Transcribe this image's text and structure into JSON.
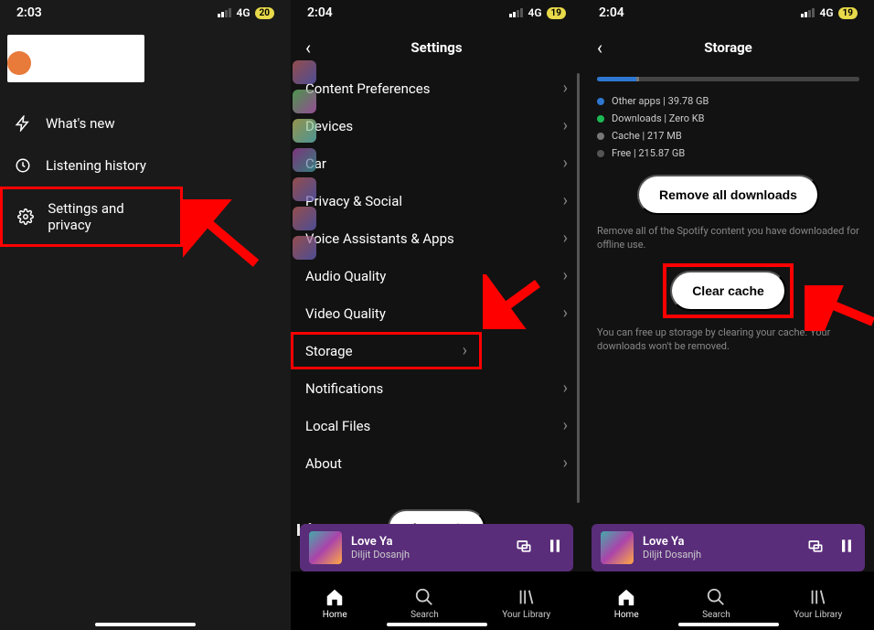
{
  "phone1": {
    "time": "2:03",
    "network": "4G",
    "battery": "20",
    "menu": [
      {
        "icon": "bolt",
        "label": "What's new"
      },
      {
        "icon": "history",
        "label": "Listening history"
      },
      {
        "icon": "gear",
        "label": "Settings and privacy",
        "highlight": true
      }
    ]
  },
  "phone2": {
    "time": "2:04",
    "network": "4G",
    "battery": "19",
    "title": "Settings",
    "items": [
      "Content Preferences",
      "Devices",
      "Car",
      "Privacy & Social",
      "Voice Assistants & Apps",
      "Audio Quality",
      "Video Quality",
      "Storage",
      "Notifications",
      "Local Files",
      "About"
    ],
    "highlight_index": 7,
    "logout": "Log out",
    "nowplaying": {
      "title": "Love Ya",
      "artist": "Diljit Dosanjh"
    },
    "nav": {
      "home": "Home",
      "search": "Search",
      "library": "Your Library"
    }
  },
  "phone3": {
    "time": "2:04",
    "network": "4G",
    "battery": "19",
    "title": "Storage",
    "segments": [
      {
        "color": "#2e77d0",
        "pct": 15
      },
      {
        "color": "#1db954",
        "pct": 0
      },
      {
        "color": "#777",
        "pct": 1
      },
      {
        "color": "#444",
        "pct": 84
      }
    ],
    "legend": [
      {
        "color": "#2e77d0",
        "label": "Other apps | 39.78 GB"
      },
      {
        "color": "#1db954",
        "label": "Downloads | Zero KB"
      },
      {
        "color": "#777",
        "label": "Cache | 217 MB"
      },
      {
        "color": "#555",
        "label": "Free | 215.87 GB"
      }
    ],
    "remove_btn": "Remove all downloads",
    "remove_desc": "Remove all of the Spotify content you have downloaded for offline use.",
    "clear_btn": "Clear cache",
    "clear_desc": "You can free up storage by clearing your cache. Your downloads won't be removed.",
    "nowplaying": {
      "title": "Love Ya",
      "artist": "Diljit Dosanjh"
    },
    "nav": {
      "home": "Home",
      "search": "Search",
      "library": "Your Library"
    }
  }
}
